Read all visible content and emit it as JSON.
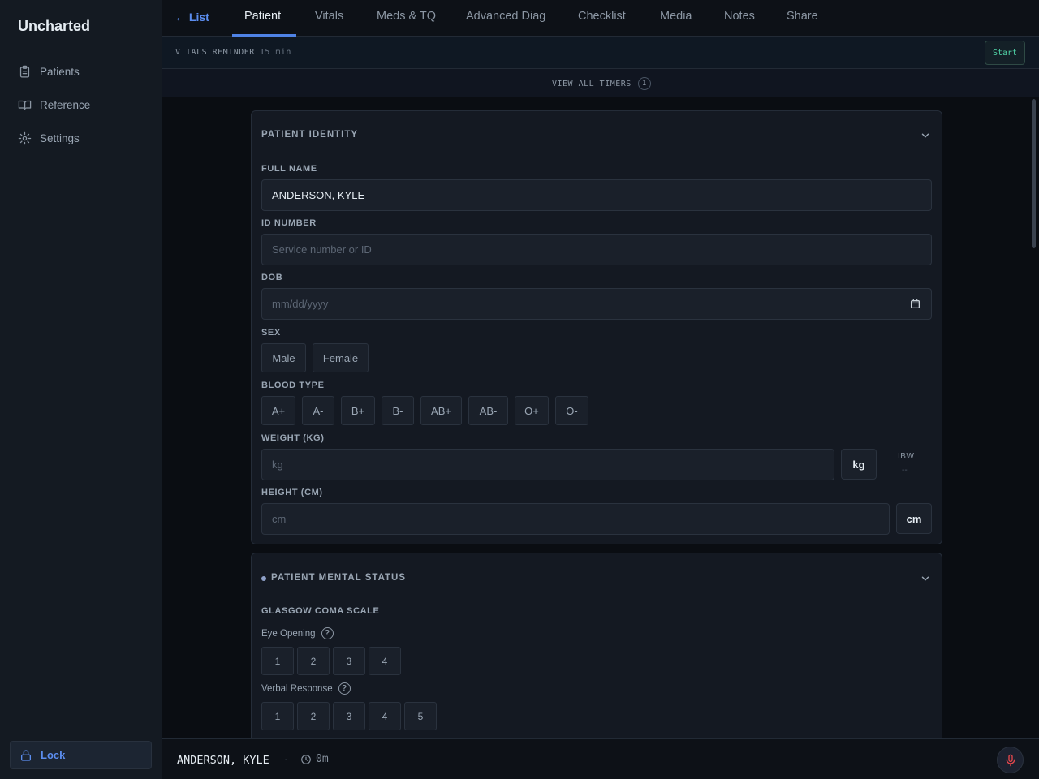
{
  "app": {
    "title": "Uncharted"
  },
  "sidebar": {
    "items": [
      {
        "label": "Patients",
        "icon": "clipboard-icon"
      },
      {
        "label": "Reference",
        "icon": "book-icon"
      },
      {
        "label": "Settings",
        "icon": "gear-icon"
      }
    ],
    "lock_label": "Lock"
  },
  "topbar": {
    "back_label": "← List",
    "tabs": [
      "Patient",
      "Vitals",
      "Meds & TQ",
      "Advanced Diag",
      "Checklist",
      "Media",
      "Notes",
      "Share"
    ],
    "active_tab": "Patient"
  },
  "reminder": {
    "label": "VITALS REMINDER",
    "interval": "15 min",
    "start_label": "Start"
  },
  "timers": {
    "label": "VIEW ALL TIMERS",
    "count": "1"
  },
  "identity": {
    "title": "PATIENT IDENTITY",
    "full_name_label": "FULL NAME",
    "full_name_value": "ANDERSON, KYLE",
    "id_label": "ID NUMBER",
    "id_placeholder": "Service number or ID",
    "dob_label": "DOB",
    "dob_placeholder": "mm/dd/yyyy",
    "sex_label": "SEX",
    "sex_options": [
      "Male",
      "Female"
    ],
    "blood_label": "BLOOD TYPE",
    "blood_options": [
      "A+",
      "A-",
      "B+",
      "B-",
      "AB+",
      "AB-",
      "O+",
      "O-"
    ],
    "weight_label": "WEIGHT (KG)",
    "weight_placeholder": "kg",
    "weight_unit": "kg",
    "ibw_label": "IBW",
    "ibw_value": "--",
    "height_label": "HEIGHT (CM)",
    "height_placeholder": "cm",
    "height_unit": "cm"
  },
  "mental": {
    "title": "PATIENT MENTAL STATUS",
    "gcs_label": "GLASGOW COMA SCALE",
    "eye_label": "Eye Opening",
    "eye_options": [
      "1",
      "2",
      "3",
      "4"
    ],
    "verbal_label": "Verbal Response",
    "verbal_options": [
      "1",
      "2",
      "3",
      "4",
      "5"
    ]
  },
  "footer": {
    "patient_name": "ANDERSON, KYLE",
    "separator": "·",
    "elapsed": "0m"
  },
  "colors": {
    "accent": "#4f83e6",
    "start": "#4fd1a5",
    "mic": "#e5484d"
  }
}
